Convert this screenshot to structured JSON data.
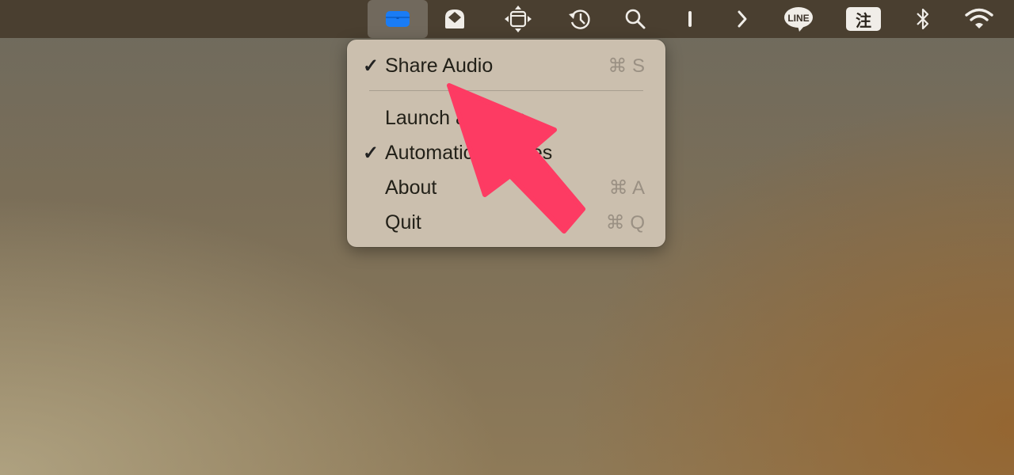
{
  "menubar": {
    "items": [
      {
        "name": "airbuddy-case-icon",
        "active": true
      },
      {
        "name": "mail-envelope-icon"
      },
      {
        "name": "window-move-icon"
      },
      {
        "name": "history-clock-icon"
      },
      {
        "name": "search-icon"
      },
      {
        "name": "text-cursor-icon"
      },
      {
        "name": "chevron-right-icon"
      },
      {
        "name": "line-app-icon",
        "text": "LINE"
      },
      {
        "name": "input-method-icon",
        "text": "注"
      },
      {
        "name": "bluetooth-icon"
      },
      {
        "name": "wifi-icon"
      }
    ],
    "accent": "#1a7cf5"
  },
  "menu": {
    "items": [
      {
        "label": "Share Audio",
        "checked": "✓",
        "shortcut": "⌘ S"
      },
      {
        "label": "Launch at Login",
        "checked": "",
        "shortcut": ""
      },
      {
        "label": "Automatic Updates",
        "checked": "✓",
        "shortcut": ""
      },
      {
        "label": "About",
        "checked": "",
        "shortcut": "⌘ A"
      },
      {
        "label": "Quit",
        "checked": "",
        "shortcut": "⌘ Q"
      }
    ]
  },
  "annotation": {
    "color": "#fd3b63"
  }
}
